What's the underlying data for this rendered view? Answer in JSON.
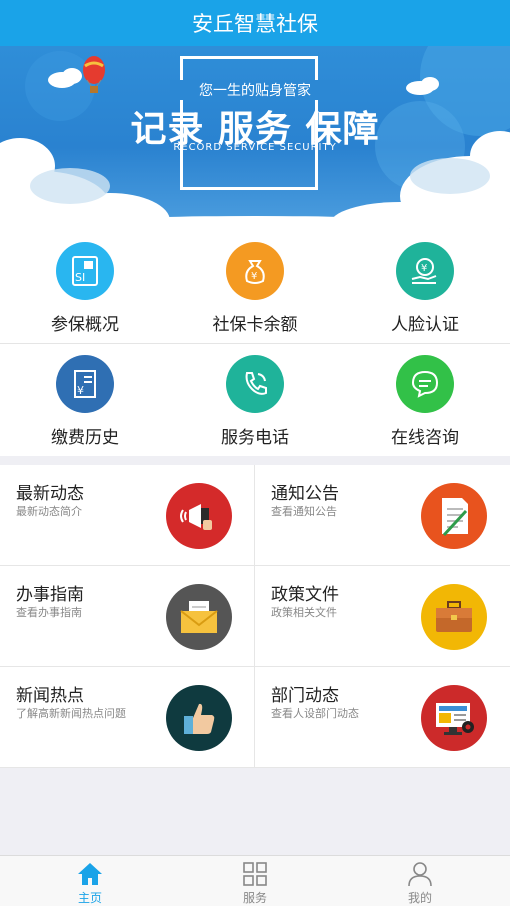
{
  "header": {
    "title": "安丘智慧社保"
  },
  "banner": {
    "subtitle": "您一生的贴身管家",
    "title": "记录 服务 保障",
    "english": "RECORD  SERVICE  SECURITY"
  },
  "grid": [
    {
      "label": "参保概况",
      "icon": "id-card-icon",
      "color": "#29b6f0"
    },
    {
      "label": "社保卡余额",
      "icon": "money-bag-icon",
      "color": "#f49a22"
    },
    {
      "label": "人脸认证",
      "icon": "hand-coin-icon",
      "color": "#1fb39a"
    },
    {
      "label": "缴费历史",
      "icon": "receipt-icon",
      "color": "#2f6fb3"
    },
    {
      "label": "服务电话",
      "icon": "phone-icon",
      "color": "#1fb39a"
    },
    {
      "label": "在线咨询",
      "icon": "chat-icon",
      "color": "#32c148"
    }
  ],
  "cards": [
    {
      "title": "最新动态",
      "desc": "最新动态简介",
      "icon": "megaphone-icon",
      "color": "#d42a2a"
    },
    {
      "title": "通知公告",
      "desc": "查看通知公告",
      "icon": "document-icon",
      "color": "#e8531e"
    },
    {
      "title": "办事指南",
      "desc": "查看办事指南",
      "icon": "envelope-icon",
      "color": "#555555"
    },
    {
      "title": "政策文件",
      "desc": "政策相关文件",
      "icon": "briefcase-icon",
      "color": "#f2b705"
    },
    {
      "title": "新闻热点",
      "desc": "了解高新新闻热点问题",
      "icon": "thumbs-up-icon",
      "color": "#0f3a3f"
    },
    {
      "title": "部门动态",
      "desc": "查看人设部门动态",
      "icon": "monitor-icon",
      "color": "#cc2a2a"
    }
  ],
  "tabs": [
    {
      "label": "主页",
      "icon": "home-icon",
      "active": true
    },
    {
      "label": "服务",
      "icon": "grid-icon",
      "active": false
    },
    {
      "label": "我的",
      "icon": "user-icon",
      "active": false
    }
  ],
  "colors": {
    "primary": "#1aa3e8",
    "background": "#efeff4"
  }
}
